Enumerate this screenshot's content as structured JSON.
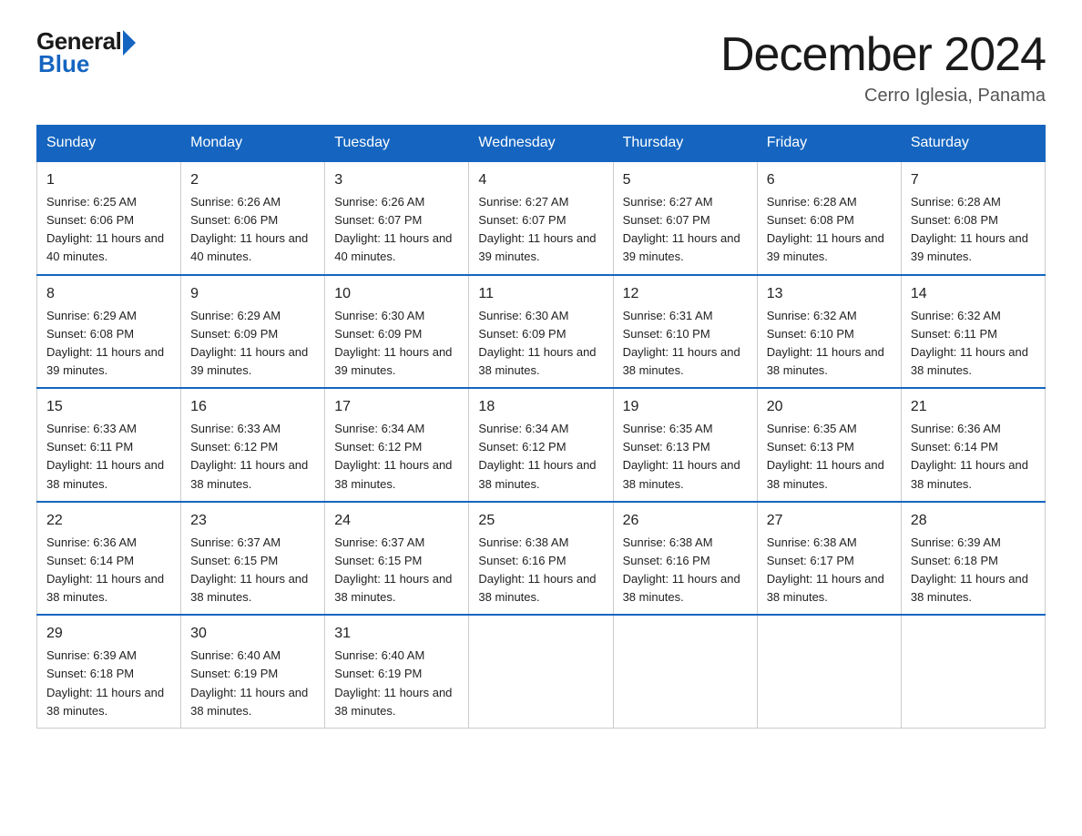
{
  "logo": {
    "general": "General",
    "blue": "Blue"
  },
  "title": "December 2024",
  "location": "Cerro Iglesia, Panama",
  "days_of_week": [
    "Sunday",
    "Monday",
    "Tuesday",
    "Wednesday",
    "Thursday",
    "Friday",
    "Saturday"
  ],
  "weeks": [
    [
      {
        "day": "1",
        "sunrise": "6:25 AM",
        "sunset": "6:06 PM",
        "daylight": "11 hours and 40 minutes."
      },
      {
        "day": "2",
        "sunrise": "6:26 AM",
        "sunset": "6:06 PM",
        "daylight": "11 hours and 40 minutes."
      },
      {
        "day": "3",
        "sunrise": "6:26 AM",
        "sunset": "6:07 PM",
        "daylight": "11 hours and 40 minutes."
      },
      {
        "day": "4",
        "sunrise": "6:27 AM",
        "sunset": "6:07 PM",
        "daylight": "11 hours and 39 minutes."
      },
      {
        "day": "5",
        "sunrise": "6:27 AM",
        "sunset": "6:07 PM",
        "daylight": "11 hours and 39 minutes."
      },
      {
        "day": "6",
        "sunrise": "6:28 AM",
        "sunset": "6:08 PM",
        "daylight": "11 hours and 39 minutes."
      },
      {
        "day": "7",
        "sunrise": "6:28 AM",
        "sunset": "6:08 PM",
        "daylight": "11 hours and 39 minutes."
      }
    ],
    [
      {
        "day": "8",
        "sunrise": "6:29 AM",
        "sunset": "6:08 PM",
        "daylight": "11 hours and 39 minutes."
      },
      {
        "day": "9",
        "sunrise": "6:29 AM",
        "sunset": "6:09 PM",
        "daylight": "11 hours and 39 minutes."
      },
      {
        "day": "10",
        "sunrise": "6:30 AM",
        "sunset": "6:09 PM",
        "daylight": "11 hours and 39 minutes."
      },
      {
        "day": "11",
        "sunrise": "6:30 AM",
        "sunset": "6:09 PM",
        "daylight": "11 hours and 38 minutes."
      },
      {
        "day": "12",
        "sunrise": "6:31 AM",
        "sunset": "6:10 PM",
        "daylight": "11 hours and 38 minutes."
      },
      {
        "day": "13",
        "sunrise": "6:32 AM",
        "sunset": "6:10 PM",
        "daylight": "11 hours and 38 minutes."
      },
      {
        "day": "14",
        "sunrise": "6:32 AM",
        "sunset": "6:11 PM",
        "daylight": "11 hours and 38 minutes."
      }
    ],
    [
      {
        "day": "15",
        "sunrise": "6:33 AM",
        "sunset": "6:11 PM",
        "daylight": "11 hours and 38 minutes."
      },
      {
        "day": "16",
        "sunrise": "6:33 AM",
        "sunset": "6:12 PM",
        "daylight": "11 hours and 38 minutes."
      },
      {
        "day": "17",
        "sunrise": "6:34 AM",
        "sunset": "6:12 PM",
        "daylight": "11 hours and 38 minutes."
      },
      {
        "day": "18",
        "sunrise": "6:34 AM",
        "sunset": "6:12 PM",
        "daylight": "11 hours and 38 minutes."
      },
      {
        "day": "19",
        "sunrise": "6:35 AM",
        "sunset": "6:13 PM",
        "daylight": "11 hours and 38 minutes."
      },
      {
        "day": "20",
        "sunrise": "6:35 AM",
        "sunset": "6:13 PM",
        "daylight": "11 hours and 38 minutes."
      },
      {
        "day": "21",
        "sunrise": "6:36 AM",
        "sunset": "6:14 PM",
        "daylight": "11 hours and 38 minutes."
      }
    ],
    [
      {
        "day": "22",
        "sunrise": "6:36 AM",
        "sunset": "6:14 PM",
        "daylight": "11 hours and 38 minutes."
      },
      {
        "day": "23",
        "sunrise": "6:37 AM",
        "sunset": "6:15 PM",
        "daylight": "11 hours and 38 minutes."
      },
      {
        "day": "24",
        "sunrise": "6:37 AM",
        "sunset": "6:15 PM",
        "daylight": "11 hours and 38 minutes."
      },
      {
        "day": "25",
        "sunrise": "6:38 AM",
        "sunset": "6:16 PM",
        "daylight": "11 hours and 38 minutes."
      },
      {
        "day": "26",
        "sunrise": "6:38 AM",
        "sunset": "6:16 PM",
        "daylight": "11 hours and 38 minutes."
      },
      {
        "day": "27",
        "sunrise": "6:38 AM",
        "sunset": "6:17 PM",
        "daylight": "11 hours and 38 minutes."
      },
      {
        "day": "28",
        "sunrise": "6:39 AM",
        "sunset": "6:18 PM",
        "daylight": "11 hours and 38 minutes."
      }
    ],
    [
      {
        "day": "29",
        "sunrise": "6:39 AM",
        "sunset": "6:18 PM",
        "daylight": "11 hours and 38 minutes."
      },
      {
        "day": "30",
        "sunrise": "6:40 AM",
        "sunset": "6:19 PM",
        "daylight": "11 hours and 38 minutes."
      },
      {
        "day": "31",
        "sunrise": "6:40 AM",
        "sunset": "6:19 PM",
        "daylight": "11 hours and 38 minutes."
      },
      null,
      null,
      null,
      null
    ]
  ]
}
